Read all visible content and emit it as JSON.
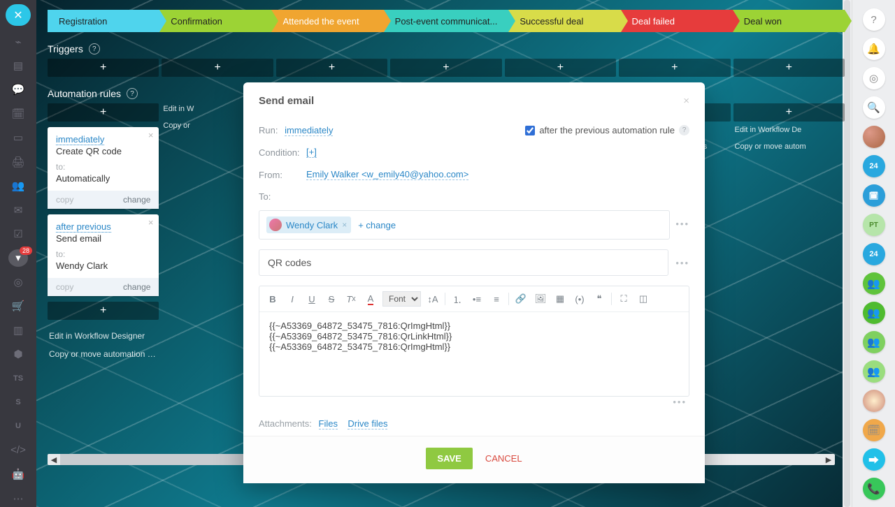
{
  "pipeline": [
    {
      "label": "Registration"
    },
    {
      "label": "Confirmation"
    },
    {
      "label": "Attended the event"
    },
    {
      "label": "Post-event communicat..."
    },
    {
      "label": "Successful deal"
    },
    {
      "label": "Deal failed"
    },
    {
      "label": "Deal won"
    }
  ],
  "sections": {
    "triggers": "Triggers",
    "automation": "Automation rules"
  },
  "col_hints": {
    "edit": "Edit in Workflow Designer",
    "copy": "Copy or move automation rules",
    "edit_short": "Edit in W",
    "copy_short": "Copy or",
    "edit_trim": "Workflow Designer",
    "copy_trim": "or move automation rules",
    "edit_cut": "Edit in Workflow De",
    "copy_cut": "Copy or move autom"
  },
  "cards": {
    "c1": {
      "when": "immediately",
      "action": "Create QR code",
      "to_label": "to:",
      "to_value": "Automatically",
      "copy": "copy",
      "change": "change"
    },
    "c2": {
      "when": "after previous",
      "action": "Send email",
      "to_label": "to:",
      "to_value": "Wendy Clark",
      "copy": "copy",
      "change": "change"
    }
  },
  "modal": {
    "title": "Send email",
    "run_label": "Run:",
    "run_value": "immediately",
    "after_prev": "after the previous automation rule",
    "cond_label": "Condition:",
    "cond_value": "[+]",
    "from_label": "From:",
    "from_value": "Emily Walker <w_emily40@yahoo.com>",
    "to_label": "To:",
    "recipient": "Wendy Clark",
    "add_change": "+ change",
    "subject": "QR codes",
    "font_label": "Font",
    "body_l1": "{{~A53369_64872_53475_7816:QrImgHtml}}",
    "body_l2": "{{~A53369_64872_53475_7816:QrLinkHtml}}",
    "body_l3": "{{~A53369_64872_53475_7816:QrImgHtml}}",
    "attach_label": "Attachments:",
    "attach_files": "Files",
    "attach_drive": "Drive files",
    "save": "SAVE",
    "cancel": "CANCEL"
  },
  "badge": "28"
}
